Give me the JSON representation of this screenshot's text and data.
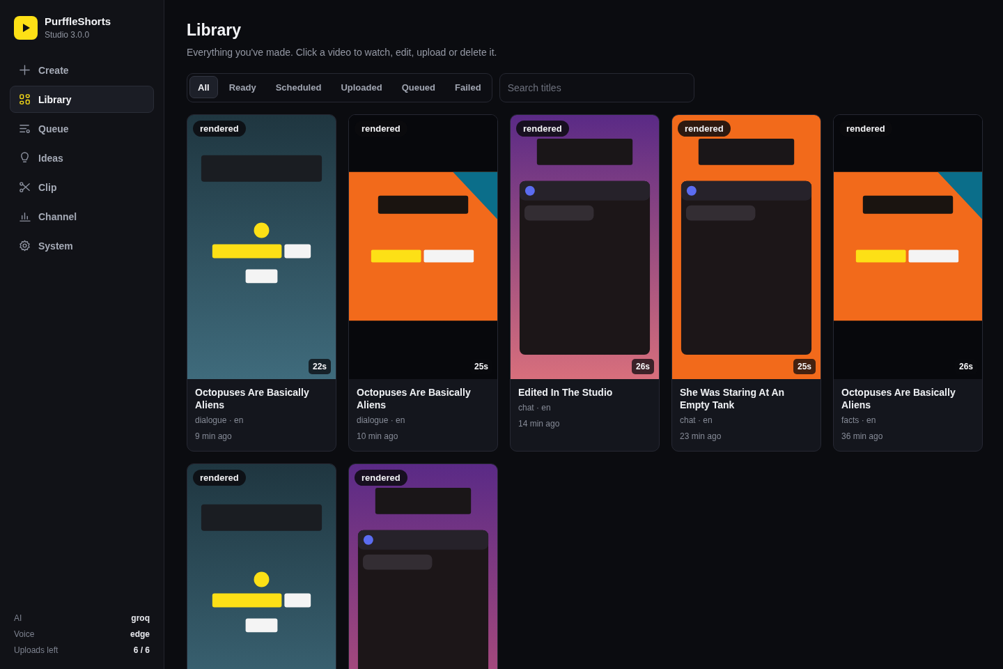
{
  "app": {
    "name": "PurffleShorts",
    "version": "Studio 3.0.0"
  },
  "nav": [
    {
      "label": "Create",
      "selected": false
    },
    {
      "label": "Library",
      "selected": true
    },
    {
      "label": "Queue",
      "selected": false
    },
    {
      "label": "Ideas",
      "selected": false
    },
    {
      "label": "Clip",
      "selected": false
    },
    {
      "label": "Channel",
      "selected": false
    },
    {
      "label": "System",
      "selected": false
    }
  ],
  "status": [
    {
      "label": "AI",
      "value": "groq"
    },
    {
      "label": "Voice",
      "value": "edge"
    },
    {
      "label": "Uploads left",
      "value": "6 / 6"
    }
  ],
  "page": {
    "title": "Library",
    "subtitle": "Everything you've made. Click a video to watch, edit, upload or delete it."
  },
  "filters": [
    {
      "label": "All",
      "selected": true
    },
    {
      "label": "Ready",
      "selected": false
    },
    {
      "label": "Scheduled",
      "selected": false
    },
    {
      "label": "Uploaded",
      "selected": false
    },
    {
      "label": "Queued",
      "selected": false
    },
    {
      "label": "Failed",
      "selected": false
    }
  ],
  "search": {
    "placeholder": "Search titles"
  },
  "videos": [
    {
      "status": "rendered",
      "duration": "22s",
      "title": "Octopuses Are Basically Aliens",
      "meta": "dialogue · en",
      "time": "9 min ago"
    },
    {
      "status": "rendered",
      "duration": "25s",
      "title": "Octopuses Are Basically Aliens",
      "meta": "dialogue · en",
      "time": "10 min ago"
    },
    {
      "status": "rendered",
      "duration": "26s",
      "title": "Edited In The Studio",
      "meta": "chat · en",
      "time": "14 min ago"
    },
    {
      "status": "rendered",
      "duration": "25s",
      "title": "She Was Staring At An Empty Tank",
      "meta": "chat · en",
      "time": "23 min ago"
    },
    {
      "status": "rendered",
      "duration": "26s",
      "title": "Octopuses Are Basically Aliens",
      "meta": "facts · en",
      "time": "36 min ago"
    },
    {
      "status": "rendered"
    },
    {
      "status": "rendered"
    }
  ]
}
